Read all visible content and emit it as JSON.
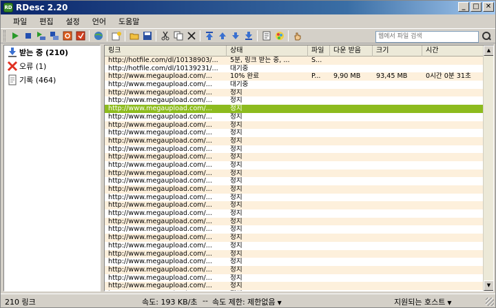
{
  "window": {
    "title": "RDesc 2.20",
    "app_icon_text": "RD",
    "btn_min": "_",
    "btn_max": "□",
    "btn_close": "✕"
  },
  "menu": [
    "파일",
    "편집",
    "설정",
    "언어",
    "도움말"
  ],
  "search": {
    "placeholder": "웹에서 파일 검색"
  },
  "sidebar": [
    {
      "label": "받는 중 (210)",
      "icon": "download-icon"
    },
    {
      "label": "오류 (1)",
      "icon": "error-icon"
    },
    {
      "label": "기록 (464)",
      "icon": "history-icon"
    }
  ],
  "columns": [
    "링크",
    "상태",
    "파일",
    "다운 받음",
    "크기",
    "시간"
  ],
  "rows": [
    [
      "http://hotfile.com/dl/10138903/...",
      "5분, 링크 받는 중, ...",
      "S...",
      "",
      "",
      ""
    ],
    [
      "http://hotfile.com/dl/10139231/...",
      "대기중",
      "",
      "",
      "",
      ""
    ],
    [
      "http://www.megaupload.com/...",
      "10% 완료",
      "P...",
      "9,90 MB",
      "93,45 MB",
      "0시간 0분 31초"
    ],
    [
      "http://www.megaupload.com/...",
      "대기중",
      "",
      "",
      "",
      ""
    ],
    [
      "http://www.megaupload.com/...",
      "정지",
      "",
      "",
      "",
      ""
    ],
    [
      "http://www.megaupload.com/...",
      "정지",
      "",
      "",
      "",
      ""
    ],
    [
      "http://www.megaupload.com/...",
      "정지",
      "",
      "",
      "",
      ""
    ],
    [
      "http://www.megaupload.com/...",
      "정지",
      "",
      "",
      "",
      ""
    ],
    [
      "http://www.megaupload.com/...",
      "정지",
      "",
      "",
      "",
      ""
    ],
    [
      "http://www.megaupload.com/...",
      "정지",
      "",
      "",
      "",
      ""
    ],
    [
      "http://www.megaupload.com/...",
      "정지",
      "",
      "",
      "",
      ""
    ],
    [
      "http://www.megaupload.com/...",
      "정지",
      "",
      "",
      "",
      ""
    ],
    [
      "http://www.megaupload.com/...",
      "정지",
      "",
      "",
      "",
      ""
    ],
    [
      "http://www.megaupload.com/...",
      "정지",
      "",
      "",
      "",
      ""
    ],
    [
      "http://www.megaupload.com/...",
      "정지",
      "",
      "",
      "",
      ""
    ],
    [
      "http://www.megaupload.com/...",
      "정지",
      "",
      "",
      "",
      ""
    ],
    [
      "http://www.megaupload.com/...",
      "정지",
      "",
      "",
      "",
      ""
    ],
    [
      "http://www.megaupload.com/...",
      "정지",
      "",
      "",
      "",
      ""
    ],
    [
      "http://www.megaupload.com/...",
      "정지",
      "",
      "",
      "",
      ""
    ],
    [
      "http://www.megaupload.com/...",
      "정지",
      "",
      "",
      "",
      ""
    ],
    [
      "http://www.megaupload.com/...",
      "정지",
      "",
      "",
      "",
      ""
    ],
    [
      "http://www.megaupload.com/...",
      "정지",
      "",
      "",
      "",
      ""
    ],
    [
      "http://www.megaupload.com/...",
      "정지",
      "",
      "",
      "",
      ""
    ],
    [
      "http://www.megaupload.com/...",
      "정지",
      "",
      "",
      "",
      ""
    ],
    [
      "http://www.megaupload.com/...",
      "정지",
      "",
      "",
      "",
      ""
    ],
    [
      "http://www.megaupload.com/...",
      "정지",
      "",
      "",
      "",
      ""
    ],
    [
      "http://www.megaupload.com/...",
      "정지",
      "",
      "",
      "",
      ""
    ],
    [
      "http://www.megaupload.com/...",
      "정지",
      "",
      "",
      "",
      ""
    ],
    [
      "http://www.megaupload.com/...",
      "정지",
      "",
      "",
      "",
      ""
    ],
    [
      "http://www.megaupload.com/...",
      "정지",
      "",
      "",
      "",
      ""
    ]
  ],
  "selected_row": 6,
  "colors": {
    "selected": "#8dbb1e",
    "row_alt": "#fdf0dc"
  },
  "status": {
    "links": "210 링크",
    "speed": "속도: 193 KB/초",
    "dash": "--",
    "limit": "속도 제한: 제한없음",
    "hosts": "지원되는 호스트"
  }
}
